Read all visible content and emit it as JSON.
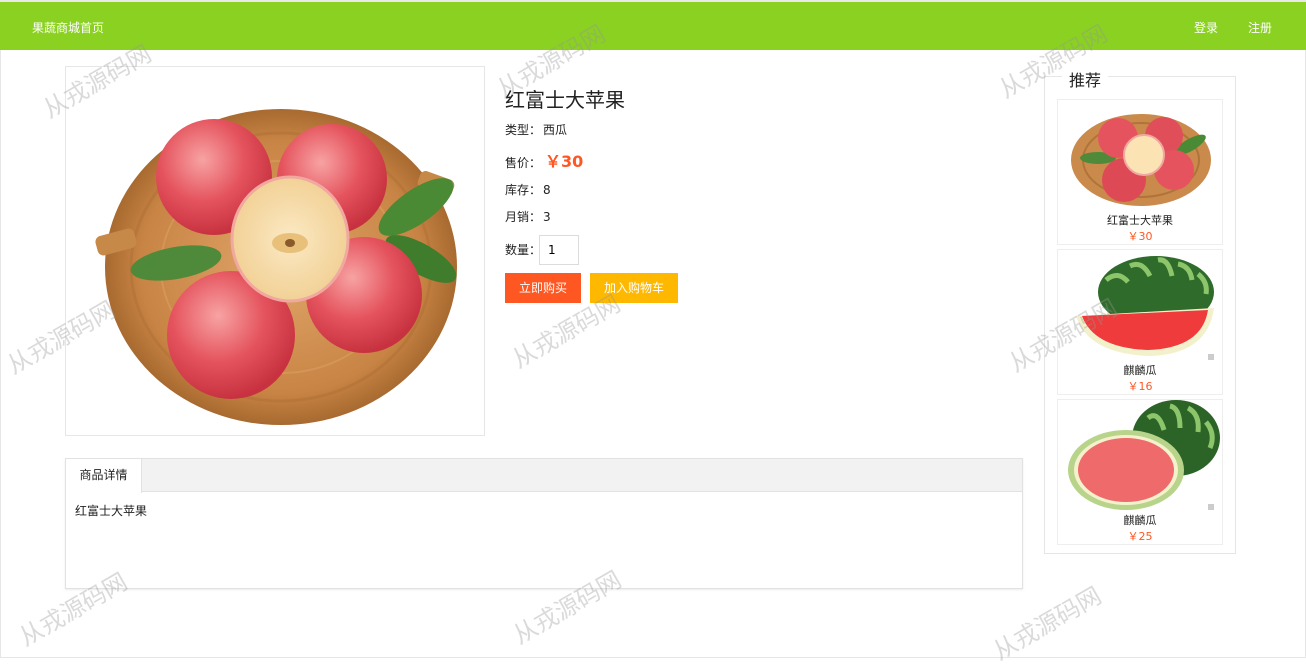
{
  "header": {
    "brand": "果蔬商城首页",
    "login": "登录",
    "register": "注册"
  },
  "product": {
    "title": "红富士大苹果",
    "type_label": "类型：",
    "type_value": "西瓜",
    "price_label": "售价：",
    "price_value": "￥30",
    "stock_label": "库存：",
    "stock_value": "8",
    "monthly_label": "月销：",
    "monthly_value": "3",
    "qty_label": "数量：",
    "qty_value": "1",
    "buy_label": "立即购买",
    "cart_label": "加入购物车"
  },
  "details": {
    "tab_label": "商品详情",
    "content": "红富士大苹果"
  },
  "sidebar": {
    "title": "推荐",
    "items": [
      {
        "name": "红富士大苹果",
        "price": "￥30"
      },
      {
        "name": "麒麟瓜",
        "price": "￥16"
      },
      {
        "name": "麒麟瓜",
        "price": "￥25"
      }
    ]
  },
  "watermark": "从戎源码网",
  "colors": {
    "header": "#8bd122",
    "accent": "#ff5722",
    "cart": "#ffb800"
  }
}
